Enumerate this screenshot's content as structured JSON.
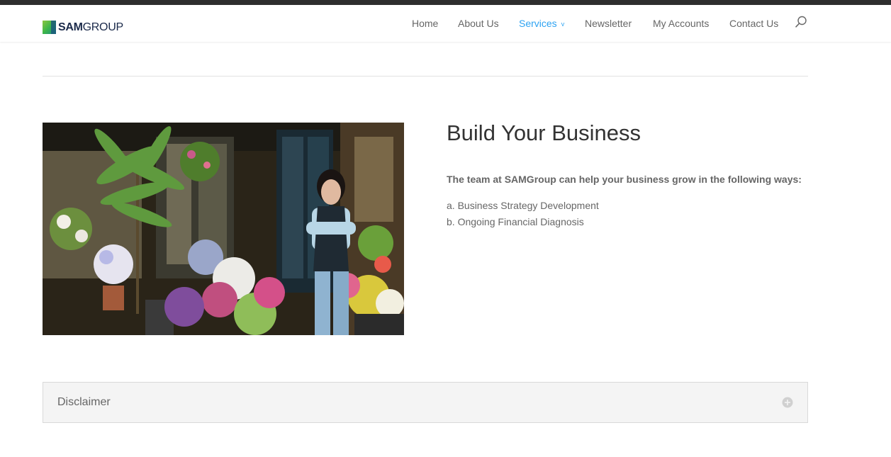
{
  "brand": {
    "name_bold": "SAM",
    "name_light": "GROUP",
    "colors": {
      "mark_green": "#3cb549",
      "mark_teal": "#1b8a8a",
      "mark_navy": "#1b2a4a"
    }
  },
  "nav": {
    "items": [
      {
        "label": "Home",
        "active": false
      },
      {
        "label": "About Us",
        "active": false
      },
      {
        "label": "Services",
        "active": true,
        "has_dropdown": true,
        "chevron": "v"
      },
      {
        "label": "Newsletter",
        "active": false
      },
      {
        "label": "My Accounts",
        "active": false
      },
      {
        "label": "Contact Us",
        "active": false
      }
    ],
    "search_icon": "search-icon",
    "accent_color": "#2ea3f2"
  },
  "main": {
    "image": "florist-woman-in-flower-shop-photo",
    "heading": "Build Your Business",
    "lead": "The team at SAMGroup can help your business grow in the following ways:",
    "list": [
      "a. Business Strategy Development",
      "b. Ongoing Financial Diagnosis"
    ]
  },
  "toggle": {
    "title": "Disclaimer",
    "icon": "plus-circle-icon",
    "expanded": false
  }
}
